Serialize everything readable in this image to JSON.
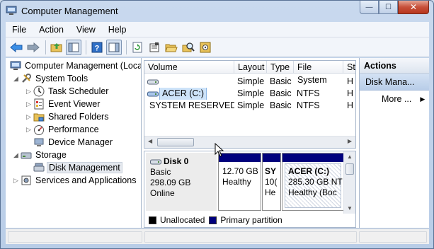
{
  "window": {
    "title": "Computer Management"
  },
  "menu": [
    "File",
    "Action",
    "View",
    "Help"
  ],
  "toolbar": {
    "icons": [
      "back-arrow-icon",
      "forward-arrow-icon",
      "up-folder-icon",
      "show-hide-tree-icon",
      "help-icon",
      "console-view-icon",
      "refresh-icon",
      "properties-icon",
      "open-folder-icon",
      "search-disk-icon",
      "settings-icon"
    ]
  },
  "tree": {
    "items": [
      {
        "label": "Computer Management (Local",
        "icon": "computer-icon",
        "level": 0
      },
      {
        "label": "System Tools",
        "icon": "tools-icon",
        "level": 1
      },
      {
        "label": "Task Scheduler",
        "icon": "clock-icon",
        "level": 2
      },
      {
        "label": "Event Viewer",
        "icon": "event-log-icon",
        "level": 2
      },
      {
        "label": "Shared Folders",
        "icon": "shared-folder-icon",
        "level": 2
      },
      {
        "label": "Performance",
        "icon": "gauge-icon",
        "level": 2
      },
      {
        "label": "Device Manager",
        "icon": "device-icon",
        "level": 2
      },
      {
        "label": "Storage",
        "icon": "storage-icon",
        "level": 1
      },
      {
        "label": "Disk Management",
        "icon": "disk-management-icon",
        "level": 2
      },
      {
        "label": "Services and Applications",
        "icon": "services-icon",
        "level": 1
      }
    ]
  },
  "volumes": {
    "columns": [
      "Volume",
      "Layout",
      "Type",
      "File System",
      "St"
    ],
    "rows": [
      {
        "volume": "",
        "layout": "Simple",
        "type": "Basic",
        "fs": "",
        "status": "H"
      },
      {
        "volume": "ACER (C:)",
        "layout": "Simple",
        "type": "Basic",
        "fs": "NTFS",
        "status": "H"
      },
      {
        "volume": "SYSTEM RESERVED",
        "layout": "Simple",
        "type": "Basic",
        "fs": "NTFS",
        "status": "H"
      }
    ]
  },
  "disk": {
    "name": "Disk 0",
    "type": "Basic",
    "size": "298.09 GB",
    "state": "Online",
    "partitions": [
      {
        "line1": "12.70 GB",
        "line2": "Healthy"
      },
      {
        "title": "SY",
        "line1": "10(",
        "line2": "He"
      },
      {
        "title": "ACER  (C:)",
        "line1": "285.30 GB NT",
        "line2": "Healthy (Boc"
      }
    ]
  },
  "legend": [
    {
      "label": "Unallocated",
      "color": "#000000"
    },
    {
      "label": "Primary partition",
      "color": "#00007d"
    }
  ],
  "actions": {
    "header": "Actions",
    "section": "Disk Mana...",
    "more": "More ..."
  },
  "window_buttons": {
    "minimize": "—",
    "maximize": "☐",
    "close": "✕"
  }
}
